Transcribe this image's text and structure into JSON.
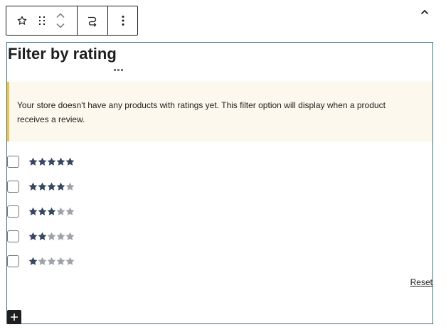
{
  "toolbar": {
    "icons": [
      "star-icon",
      "drag-handle-icon",
      "chevron-up-icon",
      "chevron-down-icon",
      "transform-icon",
      "more-options-icon"
    ]
  },
  "block": {
    "title": "Filter by rating",
    "notice": "Your store doesn't have any products with ratings yet. This filter option will display when a product receives a review.",
    "reset_label": "Reset",
    "ratings": [
      5,
      4,
      3,
      2,
      1
    ],
    "max_stars": 5
  },
  "colors": {
    "star_filled": "#364760",
    "star_empty": "#9ea3aa",
    "notice_bg": "#fdf8ee",
    "notice_border": "#f0c33c",
    "block_border": "#3c6f8f"
  }
}
